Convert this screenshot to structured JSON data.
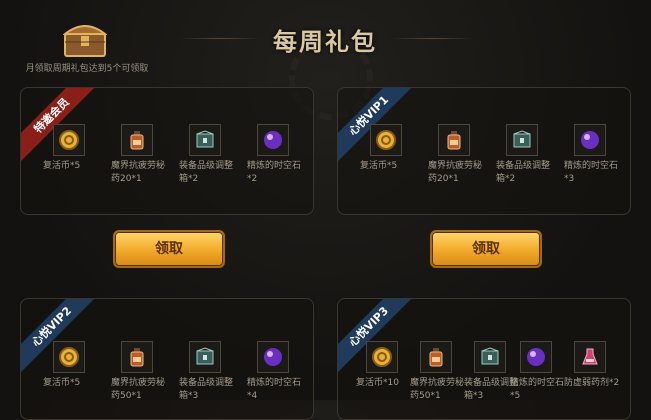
{
  "header": {
    "title": "每周礼包",
    "chest_caption": "月领取周期礼包达到5个可领取"
  },
  "panels": [
    {
      "badge": "特邀会员",
      "items": [
        {
          "icon": "coin-icon",
          "label": "复活币*5"
        },
        {
          "icon": "potion-icon",
          "label": "魔界抗疲劳秘药20*1"
        },
        {
          "icon": "equipment-box-icon",
          "label": "装备品级调整箱*2"
        },
        {
          "icon": "orb-icon",
          "label": "精炼的时空石*2"
        }
      ],
      "button": "领取"
    },
    {
      "badge": "心悦VIP1",
      "items": [
        {
          "icon": "coin-icon",
          "label": "复活币*5"
        },
        {
          "icon": "potion-icon",
          "label": "魔界抗疲劳秘药20*1"
        },
        {
          "icon": "equipment-box-icon",
          "label": "装备品级调整箱*2"
        },
        {
          "icon": "orb-icon",
          "label": "精炼的时空石*3"
        }
      ],
      "button": "领取"
    },
    {
      "badge": "心悦VIP2",
      "items": [
        {
          "icon": "coin-icon",
          "label": "复活币*5"
        },
        {
          "icon": "potion-icon",
          "label": "魔界抗疲劳秘药50*1"
        },
        {
          "icon": "equipment-box-icon",
          "label": "装备品级调整箱*3"
        },
        {
          "icon": "orb-icon",
          "label": "精炼的时空石*4"
        }
      ]
    },
    {
      "badge": "心悦VIP3",
      "items": [
        {
          "icon": "coin-icon",
          "label": "复活币*10"
        },
        {
          "icon": "potion-icon",
          "label": "魔界抗疲劳秘药50*1"
        },
        {
          "icon": "equipment-box-icon",
          "label": "装备品级调整箱*3"
        },
        {
          "icon": "orb-icon",
          "label": "精炼的时空石*5"
        },
        {
          "icon": "anti-fatigue-potion-icon",
          "label": "防虚弱药剂*2"
        }
      ]
    }
  ],
  "colors": {
    "accent_gold": "#f1a929",
    "ribbon_red": "#8a1f1a",
    "ribbon_blue": "#1f3a5a"
  }
}
